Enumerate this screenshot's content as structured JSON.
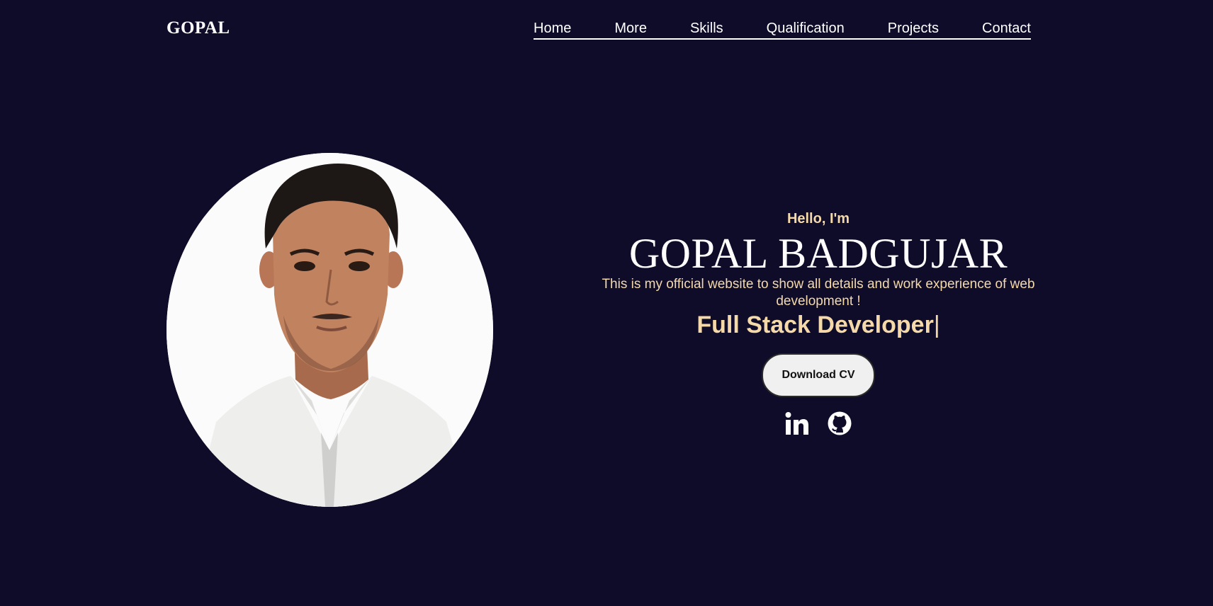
{
  "header": {
    "logo": "GOPAL",
    "nav": [
      "Home",
      "More",
      "Skills",
      "Qualification",
      "Projects",
      "Contact"
    ]
  },
  "hero": {
    "greeting": "Hello, I'm",
    "name": "GOPAL BADGUJAR",
    "tagline": "This is my official website to show all details and work experience of web development !",
    "role": "Full Stack Developer",
    "cursor": "|",
    "download_label": "Download CV",
    "socials": [
      {
        "icon": "linkedin-icon"
      },
      {
        "icon": "github-icon"
      }
    ]
  },
  "colors": {
    "background": "#0e0c29",
    "accent": "#f5d9a8",
    "text": "#ffffff",
    "button_bg": "#f0f0f0"
  }
}
